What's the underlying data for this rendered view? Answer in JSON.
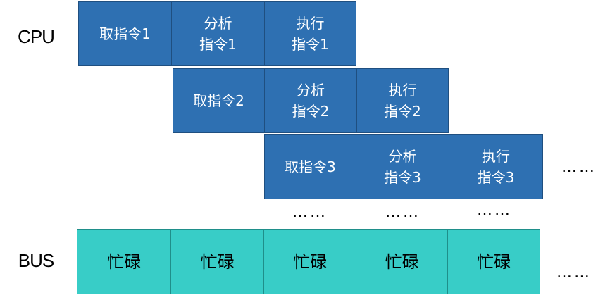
{
  "labels": {
    "cpu": "CPU",
    "bus": "BUS"
  },
  "instructions": [
    {
      "fetch": "取指令1",
      "analyze": [
        "分析",
        "指令1"
      ],
      "execute": [
        "执行",
        "指令1"
      ]
    },
    {
      "fetch": "取指令2",
      "analyze": [
        "分析",
        "指令2"
      ],
      "execute": [
        "执行",
        "指令2"
      ]
    },
    {
      "fetch": "取指令3",
      "analyze": [
        "分析",
        "指令3"
      ],
      "execute": [
        "执行",
        "指令3"
      ]
    }
  ],
  "bus": [
    "忙碌",
    "忙碌",
    "忙碌",
    "忙碌",
    "忙碌"
  ],
  "ellipsis": "…",
  "colors": {
    "cpu_box": "#2e70b2",
    "bus_box": "#38cdc7"
  }
}
